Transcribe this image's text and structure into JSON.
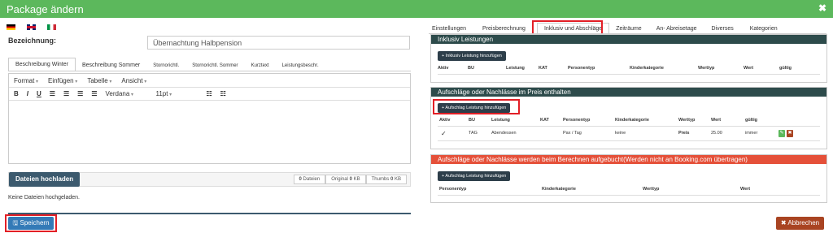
{
  "window": {
    "title": "Package ändern",
    "close_glyph": "✖"
  },
  "flags": [
    "flag-de",
    "flag-gb",
    "flag-it"
  ],
  "bezeichnung": {
    "label": "Bezeichnung:",
    "value": "Übernachtung Halbpension"
  },
  "desc_tabs": [
    "Beschreibung Winter",
    "Beschreibung Sommer",
    "Stornorichtl.",
    "Stornorichtl. Sommer",
    "Kurztext",
    "Leistungsbeschr."
  ],
  "editor": {
    "menu": [
      "Format",
      "Einfügen",
      "Tabelle",
      "Ansicht"
    ],
    "font": "Verdana",
    "size": "11pt"
  },
  "upload": {
    "button": "Dateien hochladen",
    "files_count": "0",
    "files_label": "Dateien",
    "original_label": "Original",
    "original_value": "0",
    "original_unit": "KB",
    "thumbs_label": "Thumbs",
    "thumbs_value": "0",
    "thumbs_unit": "KB",
    "empty_text": "Keine Dateien hochgeladen."
  },
  "actions": {
    "save": "Speichern",
    "cancel": "Abbrechen"
  },
  "right_tabs": [
    "Einstellungen",
    "Preisberechnung",
    "Inklusiv und Abschläge",
    "Zeiträume",
    "An- Abreisetage",
    "Diverses",
    "Kategorien"
  ],
  "inklusiv": {
    "title": "Inklusiv Leistungen",
    "add_button": "+ Inklusiv Leistung hinzufügen",
    "columns": [
      "Aktiv",
      "BU",
      "Leistung",
      "KAT",
      "Personentyp",
      "Kinderkategorie",
      "Werttyp",
      "Wert",
      "gültig"
    ]
  },
  "aufschlaege_enthalten": {
    "title": "Aufschläge oder Nachlässe im Preis enthalten",
    "add_button": "+ Aufschlag Leistung hinzufügen",
    "columns": [
      "Aktiv",
      "BU",
      "Leistung",
      "KAT",
      "Personentyp",
      "Kinderkategorie",
      "Werttyp",
      "Wert",
      "gültig"
    ],
    "rows": [
      {
        "aktiv": "✓",
        "bu": "TAG",
        "leistung": "Abendessen",
        "kat": "",
        "personentyp": "Pax / Tag",
        "kinderkategorie": "keine",
        "werttyp": "Preis",
        "wert": "25.00",
        "gueltig": "immer"
      }
    ]
  },
  "aufschlaege_extra": {
    "title": "Aufschläge oder Nachlässe werden beim Berechnen aufgebucht(Werden nicht an Booking.com übertragen)",
    "add_button": "+ Aufschlag Leistung hinzufügen",
    "columns": [
      "Personentyp",
      "Kinderkategorie",
      "Werttyp",
      "Wert"
    ]
  }
}
